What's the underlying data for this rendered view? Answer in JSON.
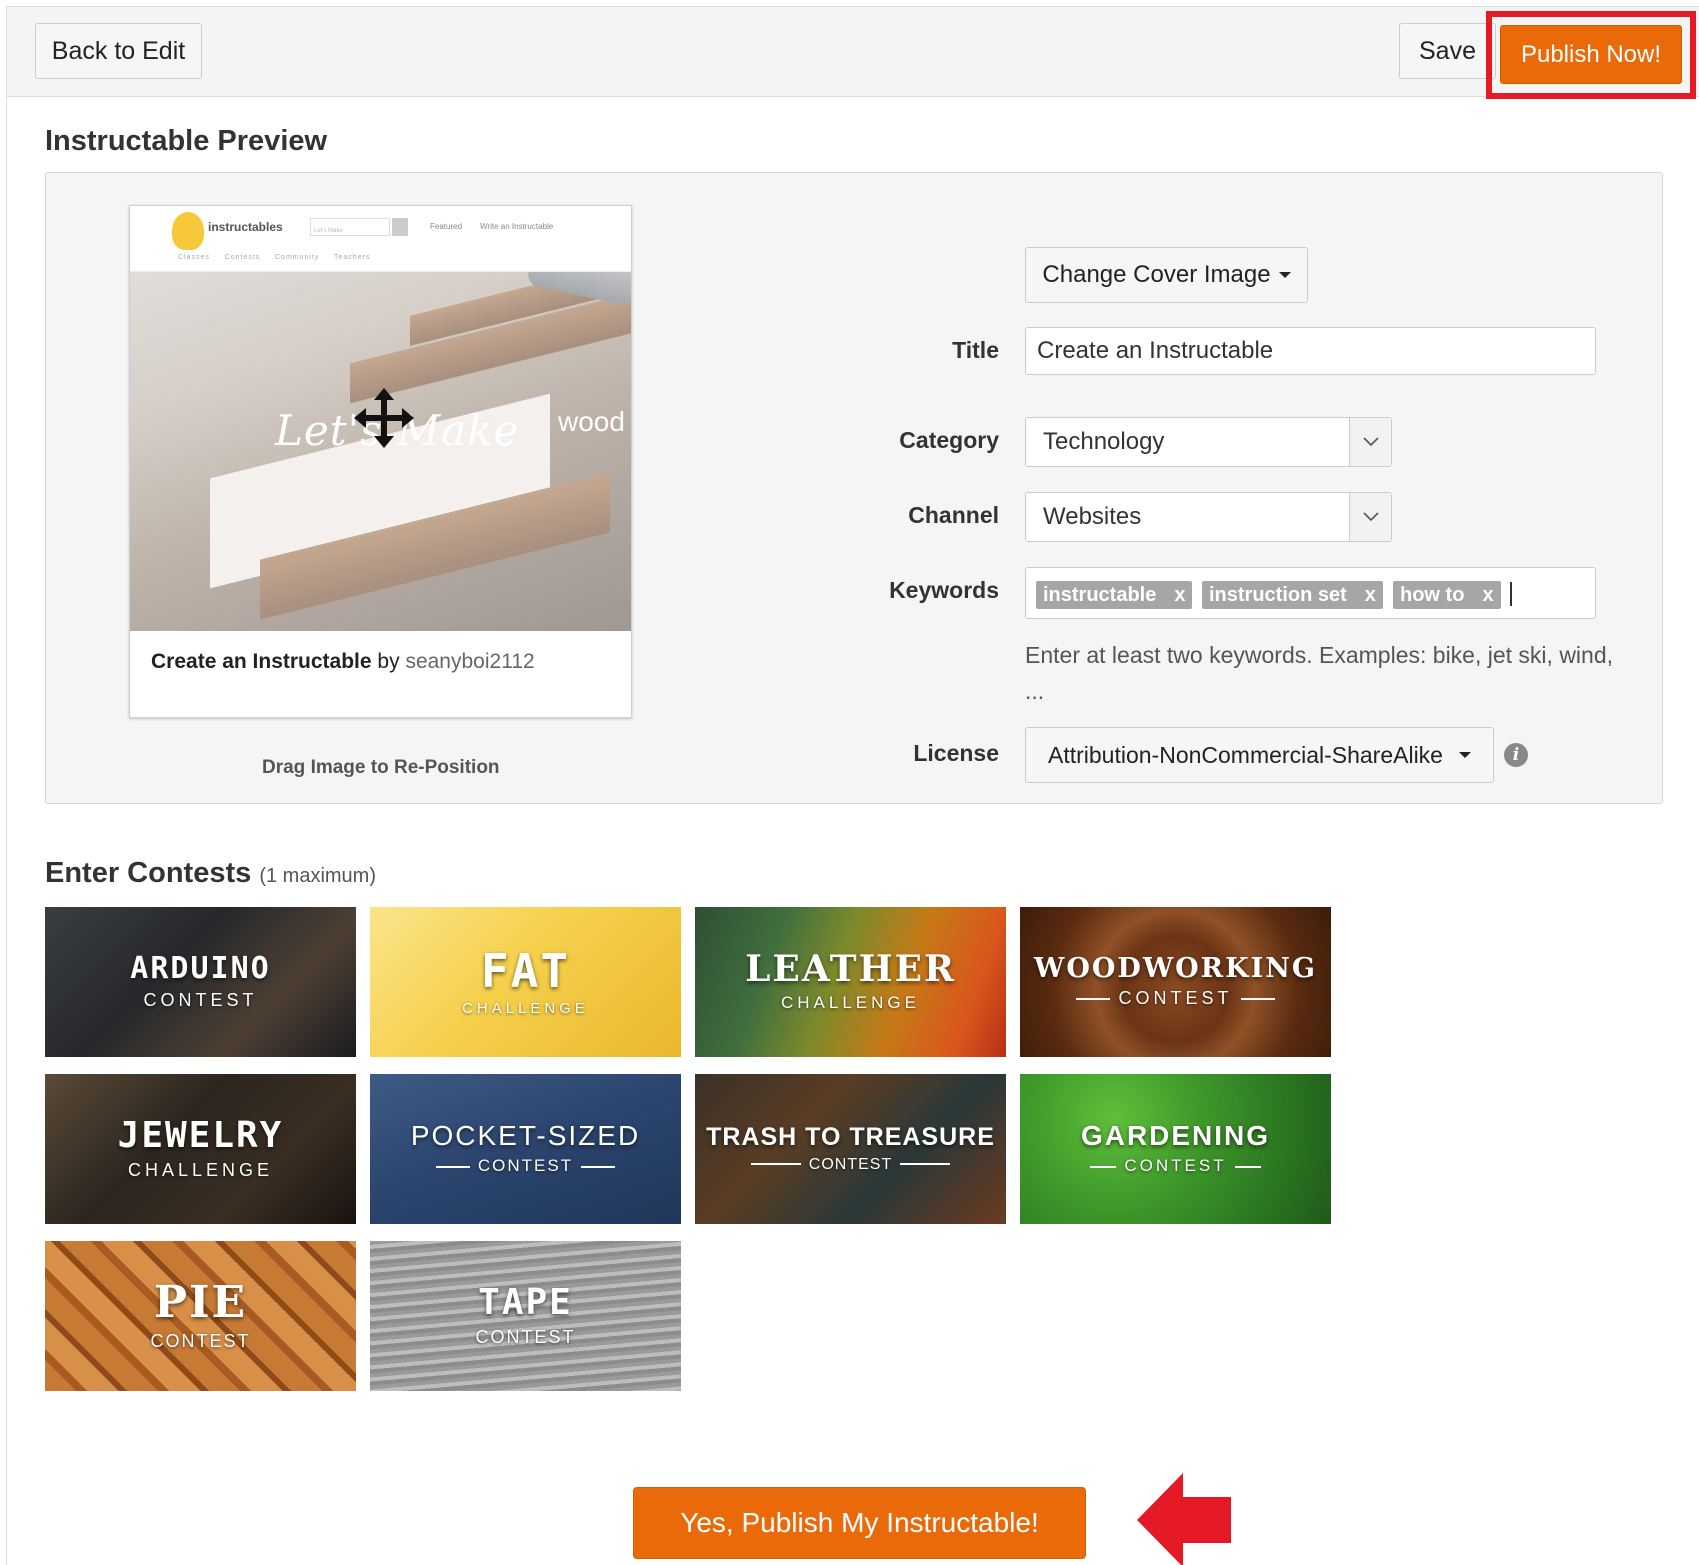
{
  "toolbar": {
    "back_label": "Back to Edit",
    "save_label": "Save",
    "publish_label": "Publish Now!"
  },
  "preview": {
    "heading": "Instructable Preview",
    "card": {
      "mini_brand": "instructables",
      "mini_search_placeholder": "Let's Make",
      "mini_nav": [
        "Featured",
        "Write an Instructable"
      ],
      "mini_subnav": [
        "Classes",
        "Contests",
        "Community",
        "Teachers"
      ],
      "cover_text": "Let's Make",
      "cover_text2": "wood",
      "title": "Create an Instructable",
      "by": "by",
      "author": "seanyboi2112"
    },
    "drag_hint": "Drag Image to Re-Position"
  },
  "form": {
    "change_cover_label": "Change Cover Image",
    "title_label": "Title",
    "title_value": "Create an Instructable",
    "category_label": "Category",
    "category_value": "Technology",
    "channel_label": "Channel",
    "channel_value": "Websites",
    "keywords_label": "Keywords",
    "keywords": [
      "instructable",
      "instruction set",
      "how to"
    ],
    "keyword_remove": "x",
    "keywords_hint": "Enter at least two keywords. Examples: bike, jet ski, wind, ...",
    "license_label": "License",
    "license_value": "Attribution-NonCommercial-ShareAlike",
    "info_icon": "i"
  },
  "contests": {
    "heading": "Enter Contests",
    "note": "(1 maximum)",
    "items": [
      {
        "name": "ARDUINO",
        "sub": "CONTEST"
      },
      {
        "name": "FAT",
        "sub": "CHALLENGE"
      },
      {
        "name": "LEATHER",
        "sub": "CHALLENGE"
      },
      {
        "name": "WOODWORKING",
        "sub": "CONTEST"
      },
      {
        "name": "JEWELRY",
        "sub": "CHALLENGE"
      },
      {
        "name": "POCKET-SIZED",
        "sub": "CONTEST"
      },
      {
        "name": "TRASH TO TREASURE",
        "sub": "CONTEST"
      },
      {
        "name": "GARDENING",
        "sub": "CONTEST"
      },
      {
        "name": "PIE",
        "sub": "CONTEST"
      },
      {
        "name": "TAPE",
        "sub": "CONTEST"
      }
    ]
  },
  "footer": {
    "yes_publish_label": "Yes, Publish My Instructable!"
  },
  "colors": {
    "accent": "#ea6a0a",
    "highlight": "#e51a26",
    "tag_bg": "#a6a6a6"
  }
}
